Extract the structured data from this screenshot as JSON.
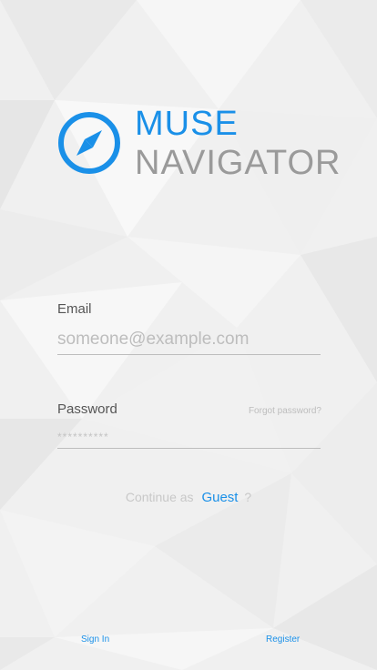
{
  "brand": {
    "line1": "MUSE",
    "line2": "NAVIGATOR",
    "accent": "#1a90e8",
    "muted": "#9a9a9a"
  },
  "email": {
    "label": "Email",
    "placeholder": "someone@example.com"
  },
  "password": {
    "label": "Password",
    "placeholder": "**********",
    "forgot_label": "Forgot password?"
  },
  "guest": {
    "prefix": "Continue as",
    "link": "Guest",
    "suffix": "?"
  },
  "footer": {
    "signin_label": "Sign In",
    "register_label": "Register"
  },
  "icons": {
    "logo": "compass-icon"
  }
}
